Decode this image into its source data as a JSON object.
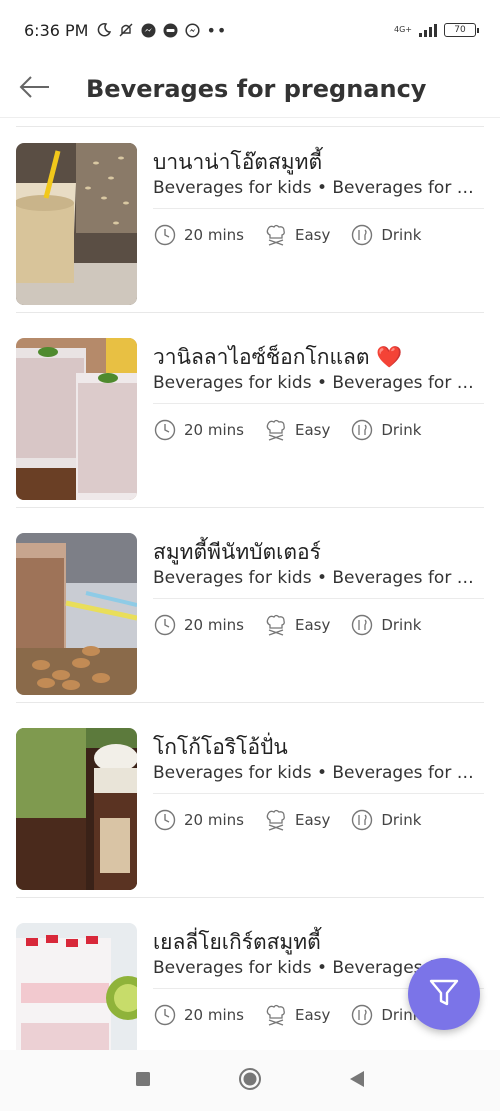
{
  "status_bar": {
    "time": "6:36 PM",
    "network": "4G+",
    "battery": "70",
    "more": "••",
    "icons": [
      "moon-icon",
      "mute-icon",
      "messenger-icon",
      "line-icon",
      "messenger-alt-icon",
      "signal-icon",
      "battery-icon"
    ]
  },
  "header": {
    "title": "Beverages for pregnancy",
    "back_icon": "arrow-left-icon"
  },
  "recipes": [
    {
      "title": "บานาน่าโอ๊ตสมูทตี้",
      "category": "Beverages for kids • Beverages for breastfeeding",
      "time": "20 mins",
      "difficulty": "Easy",
      "type": "Drink",
      "image_icon": "banana-oat-smoothie-photo"
    },
    {
      "title": "วานิลลาไอซ์ช็อกโกแลต ❤️",
      "category": "Beverages for kids • Beverages for breastfeeding",
      "time": "20 mins",
      "difficulty": "Easy",
      "type": "Drink",
      "image_icon": "vanilla-ice-chocolate-photo"
    },
    {
      "title": "สมูทตี้พีนัทบัตเตอร์",
      "category": "Beverages for kids • Beverages for breastfeeding",
      "time": "20 mins",
      "difficulty": "Easy",
      "type": "Drink",
      "image_icon": "peanut-butter-smoothie-photo"
    },
    {
      "title": "โกโก้โอริโอ้ปั่น",
      "category": "Beverages for kids • Beverages for breastfeeding",
      "time": "20 mins",
      "difficulty": "Easy",
      "type": "Drink",
      "image_icon": "cocoa-oreo-frappe-photo"
    },
    {
      "title": "เยลลี่โยเกิร์ตสมูทตี้",
      "category": "Beverages for kids • Beverages for breastfeeding",
      "time": "20 mins",
      "difficulty": "Easy",
      "type": "Drink",
      "image_icon": "jelly-yogurt-smoothie-photo"
    }
  ],
  "fab": {
    "icon": "filter-icon"
  },
  "nav": {
    "icons": [
      "recents-square-icon",
      "home-circle-icon",
      "back-triangle-icon"
    ]
  },
  "colors": {
    "accent": "#7b74e8",
    "text": "#222222",
    "divider": "#e8e8e8"
  }
}
